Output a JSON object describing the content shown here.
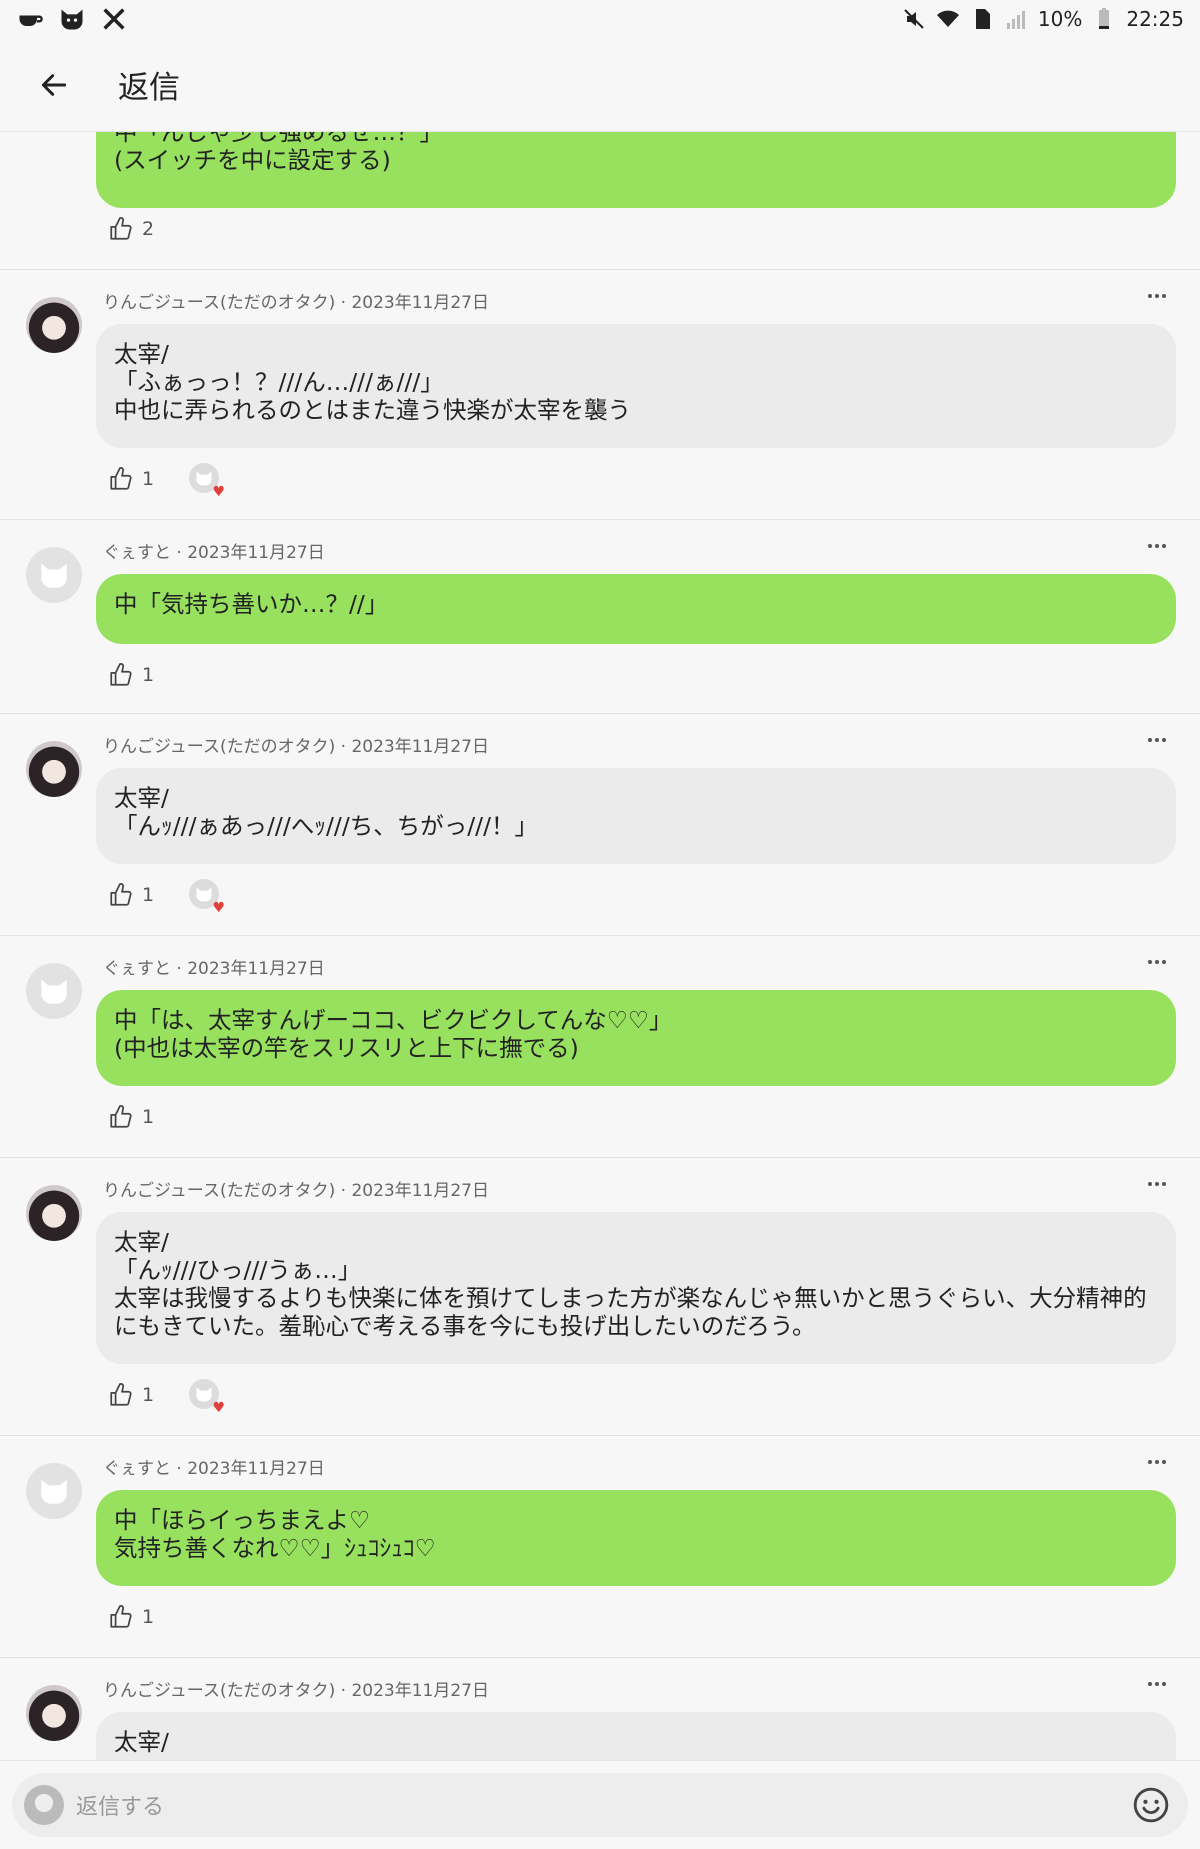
{
  "status": {
    "battery": "10%",
    "time": "22:25"
  },
  "header": {
    "title": "返信"
  },
  "top_post": {
    "text": "中「んじゃ少し強めるぜ…？」\n(スイッチを中に設定する)",
    "likes": "2"
  },
  "posts": [
    {
      "author": "りんごジュース(ただのオタク)",
      "date": "2023年11月27日",
      "avatar": "dark",
      "bubble": "gray",
      "text": "太宰/\n「ふぁっっ！？///ん…///ぁ///」\n中也に弄られるのとはまた違う快楽が太宰を襲う",
      "likes": "1",
      "reaction": true
    },
    {
      "author": "ぐぇすと",
      "date": "2023年11月27日",
      "avatar": "guest",
      "bubble": "green",
      "text": "中「気持ち善いか…？//」",
      "likes": "1",
      "reaction": false
    },
    {
      "author": "りんごジュース(ただのオタク)",
      "date": "2023年11月27日",
      "avatar": "dark",
      "bubble": "gray",
      "text": "太宰/\n「んｯ///ぁあっ///へｯ///ち、ちがっ///！」",
      "likes": "1",
      "reaction": true
    },
    {
      "author": "ぐぇすと",
      "date": "2023年11月27日",
      "avatar": "guest",
      "bubble": "green",
      "text": "中「は、太宰すんげーココ、ビクビクしてんな♡♡」\n(中也は太宰の竿をスリスリと上下に撫でる)",
      "likes": "1",
      "reaction": false
    },
    {
      "author": "りんごジュース(ただのオタク)",
      "date": "2023年11月27日",
      "avatar": "dark",
      "bubble": "gray",
      "text": "太宰/\n「んｯ///ひっ///うぁ…」\n太宰は我慢するよりも快楽に体を預けてしまった方が楽なんじゃ無いかと思うぐらい、大分精神的にもきていた。羞恥心で考える事を今にも投げ出したいのだろう。",
      "likes": "1",
      "reaction": true
    },
    {
      "author": "ぐぇすと",
      "date": "2023年11月27日",
      "avatar": "guest",
      "bubble": "green",
      "text": "中「ほらイっちまえよ♡\n気持ち善くなれ♡♡」ｼｭｺｼｭｺ♡",
      "likes": "1",
      "reaction": false
    },
    {
      "author": "りんごジュース(ただのオタク)",
      "date": "2023年11月27日",
      "avatar": "dark",
      "bubble": "gray",
      "text": "太宰/",
      "likes": "",
      "reaction": false
    }
  ],
  "reply": {
    "placeholder": "返信する"
  },
  "colors": {
    "green_bubble": "#98e15f",
    "gray_bubble": "#ebebeb",
    "heart": "#e2403f"
  }
}
